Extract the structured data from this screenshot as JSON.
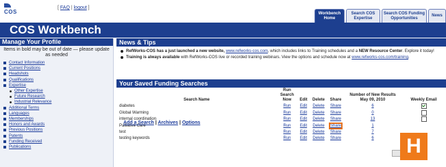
{
  "header": {
    "logo_text": "COS",
    "help_links": [
      "FAQ",
      "logout"
    ],
    "tabs": [
      {
        "label": "Workbench Home",
        "active": true
      },
      {
        "label": "Search COS Expertise",
        "active": false
      },
      {
        "label": "Search COS Funding Opportunities",
        "active": false
      },
      {
        "label": "News",
        "active": false
      }
    ],
    "title": "COS Workbench"
  },
  "profile": {
    "heading": "Manage Your Profile",
    "note": "Items in bold may be out of date — please update as needed",
    "items": [
      {
        "label": "Contact Information",
        "sub": false
      },
      {
        "label": "Current Positions",
        "sub": false
      },
      {
        "label": "Headshots",
        "sub": false
      },
      {
        "label": "Qualifications",
        "sub": false
      },
      {
        "label": "Expertise",
        "sub": false
      },
      {
        "label": "Other Expertise",
        "sub": true
      },
      {
        "label": "Future Research",
        "sub": true
      },
      {
        "label": "Industrial Relevance",
        "sub": true
      },
      {
        "label": "Additional Terms",
        "sub": false
      },
      {
        "label": "Languages",
        "sub": false
      },
      {
        "label": "Memberships",
        "sub": false
      },
      {
        "label": "Honors and Awards",
        "sub": false
      },
      {
        "label": "Previous Positions",
        "sub": false
      },
      {
        "label": "Patents",
        "sub": false
      },
      {
        "label": "Funding Received",
        "sub": false
      },
      {
        "label": "Publications",
        "sub": false
      }
    ]
  },
  "news": {
    "heading": "News & Tips",
    "item1_bold": "RefWorks-COS has a just launched a new website,",
    "item1_link": "www.refworks-cos.com",
    "item1_rest": ", which includes links to Training schedules and a",
    "item1_bold2": "NEW Resource Center",
    "item1_end": ". Explore it today!",
    "item2_bold": "Training is always available",
    "item2_rest": "with RefWorks-COS live or recorded training webinars. View the options and schedule now at",
    "item2_link": "www.refworks-cos.com/training",
    "item2_end": "."
  },
  "funding": {
    "heading": "Your Saved Funding Searches",
    "columns": {
      "name": "Search Name",
      "run": "Run Search Now",
      "edit": "Edit",
      "delete": "Delete",
      "share": "Share",
      "results": "Number of New Results",
      "date": "May 09, 2010",
      "email": "Weekly Email"
    },
    "action_labels": {
      "run": "Run",
      "edit": "Edit",
      "delete": "Delete",
      "share": "Share"
    },
    "rows": [
      {
        "name": "diabetes",
        "results": "6",
        "email": true
      },
      {
        "name": "Global Warming",
        "results": "0",
        "email": false
      },
      {
        "name": "internal coordination",
        "results": "13",
        "email": false
      },
      {
        "name": "Palliative Care",
        "results": "1",
        "email": false
      },
      {
        "name": "test",
        "results": "7",
        "email": false
      },
      {
        "name": "testing keywords",
        "results": "6",
        "email": false
      }
    ],
    "highlighted_row": 3,
    "links": [
      "Add a Search",
      "Archives",
      "Options"
    ],
    "link_sep": "|"
  },
  "overlay": {
    "badge_letter": "H",
    "badge_color": "#ef7a1a"
  }
}
